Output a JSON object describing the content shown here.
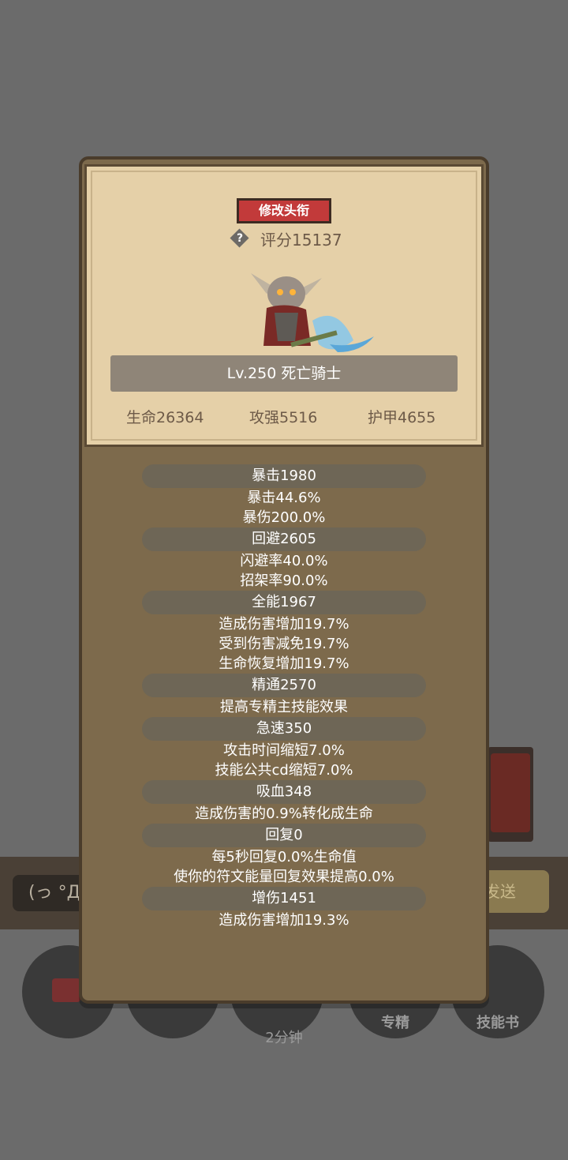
{
  "background": {
    "input_text": "(っ °Д °",
    "send_label": "发送",
    "bottom_buttons": [
      {
        "label": ""
      },
      {
        "label": ""
      },
      {
        "label": "2分钟"
      },
      {
        "label": "专精"
      },
      {
        "label": "技能书"
      }
    ]
  },
  "panel": {
    "title_button": "修改头衔",
    "score": "评分15137",
    "level_name": "Lv.250 死亡骑士",
    "stats": [
      {
        "label": "生命26364"
      },
      {
        "label": "攻强5516"
      },
      {
        "label": "护甲4655"
      }
    ],
    "groups": [
      {
        "header": "暴击1980",
        "lines": [
          "暴击44.6%",
          "暴伤200.0%"
        ]
      },
      {
        "header": "回避2605",
        "lines": [
          "闪避率40.0%",
          "招架率90.0%"
        ]
      },
      {
        "header": "全能1967",
        "lines": [
          "造成伤害增加19.7%",
          "受到伤害减免19.7%",
          "生命恢复增加19.7%"
        ]
      },
      {
        "header": "精通2570",
        "lines": [
          "提高专精主技能效果"
        ]
      },
      {
        "header": "急速350",
        "lines": [
          "攻击时间缩短7.0%",
          "技能公共cd缩短7.0%"
        ]
      },
      {
        "header": "吸血348",
        "lines": [
          "造成伤害的0.9%转化成生命"
        ]
      },
      {
        "header": "回复0",
        "lines": [
          "每5秒回复0.0%生命值",
          "使你的符文能量回复效果提高0.0%"
        ]
      },
      {
        "header": "增伤1451",
        "lines": [
          "造成伤害增加19.3%"
        ]
      }
    ]
  }
}
